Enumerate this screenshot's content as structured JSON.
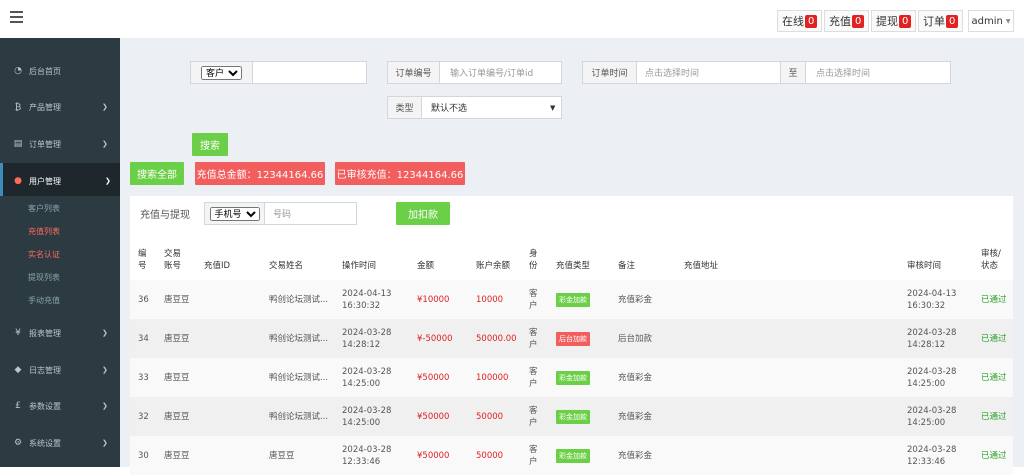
{
  "topbar": {
    "stats": [
      {
        "label": "在线",
        "count": "0"
      },
      {
        "label": "充值",
        "count": "0"
      },
      {
        "label": "提现",
        "count": "0"
      },
      {
        "label": "订单",
        "count": "0"
      }
    ],
    "admin": "admin"
  },
  "sidebar": {
    "items": [
      {
        "icon": "dashboard-icon",
        "label": "后台首页"
      },
      {
        "icon": "bitcoin-icon",
        "label": "产品管理"
      },
      {
        "icon": "order-icon",
        "label": "订单管理"
      },
      {
        "icon": "user-icon",
        "label": "用户管理"
      },
      {
        "icon": "yen-icon",
        "label": "报表管理"
      },
      {
        "icon": "log-icon",
        "label": "日志管理"
      },
      {
        "icon": "pound-icon",
        "label": "参数设置"
      },
      {
        "icon": "gears-icon",
        "label": "系统设置"
      }
    ],
    "submenu": [
      "客户列表",
      "充值列表",
      "实名认证",
      "提现列表",
      "手动充值"
    ]
  },
  "filters": {
    "customer_select": "客户",
    "order_label": "订单编号",
    "order_placeholder": "输入订单编号/订单id",
    "time_label": "订单时间",
    "time_placeholder": "点击选择时间",
    "to_label": "至",
    "type_label": "类型",
    "type_value": "默认不选",
    "search_btn": "搜索"
  },
  "actions": {
    "search_all": "搜索全部",
    "total_recharge": "充值总金额：12344164.66",
    "audited_recharge": "已审核充值：12344164.66"
  },
  "panel": {
    "title": "充值与提现",
    "phone_select": "手机号",
    "phone_placeholder": "号码",
    "deduct_btn": "加扣款"
  },
  "table": {
    "headers": [
      "编号",
      "交易账号",
      "充值ID",
      "交易姓名",
      "操作时间",
      "金额",
      "账户余额",
      "身份",
      "充值类型",
      "备注",
      "充值地址",
      "审核时间",
      "审核/状态"
    ],
    "rows": [
      {
        "id": "36",
        "account": "唐豆豆",
        "rid": "",
        "name": "鸭创论坛测试...",
        "time": "2024-04-13 16:30:32",
        "amount": "¥10000",
        "balance": "10000",
        "role": "客户",
        "type": "彩金加款",
        "note": "充值彩金",
        "addr": "",
        "atime": "2024-04-13 16:30:32",
        "status": "已通过"
      },
      {
        "id": "34",
        "account": "唐豆豆",
        "rid": "",
        "name": "鸭创论坛测试...",
        "time": "2024-03-28 14:28:12",
        "amount": "¥-50000",
        "balance": "50000.00",
        "role": "客户",
        "type": "后台加款",
        "note": "后台加款",
        "addr": "",
        "atime": "2024-03-28 14:28:12",
        "status": "已通过"
      },
      {
        "id": "33",
        "account": "唐豆豆",
        "rid": "",
        "name": "鸭创论坛测试...",
        "time": "2024-03-28 14:25:00",
        "amount": "¥50000",
        "balance": "100000",
        "role": "客户",
        "type": "彩金加款",
        "note": "充值彩金",
        "addr": "",
        "atime": "2024-03-28 14:25:00",
        "status": "已通过"
      },
      {
        "id": "32",
        "account": "唐豆豆",
        "rid": "",
        "name": "鸭创论坛测试...",
        "time": "2024-03-28 14:25:00",
        "amount": "¥50000",
        "balance": "50000",
        "role": "客户",
        "type": "彩金加款",
        "note": "充值彩金",
        "addr": "",
        "atime": "2024-03-28 14:25:00",
        "status": "已通过"
      },
      {
        "id": "30",
        "account": "唐豆豆",
        "rid": "",
        "name": "唐豆豆",
        "time": "2024-03-28 12:33:46",
        "amount": "¥50000",
        "balance": "50000",
        "role": "客户",
        "type": "彩金加款",
        "note": "充值彩金",
        "addr": "",
        "atime": "2024-03-28 12:33:46",
        "status": "已通过"
      }
    ]
  }
}
